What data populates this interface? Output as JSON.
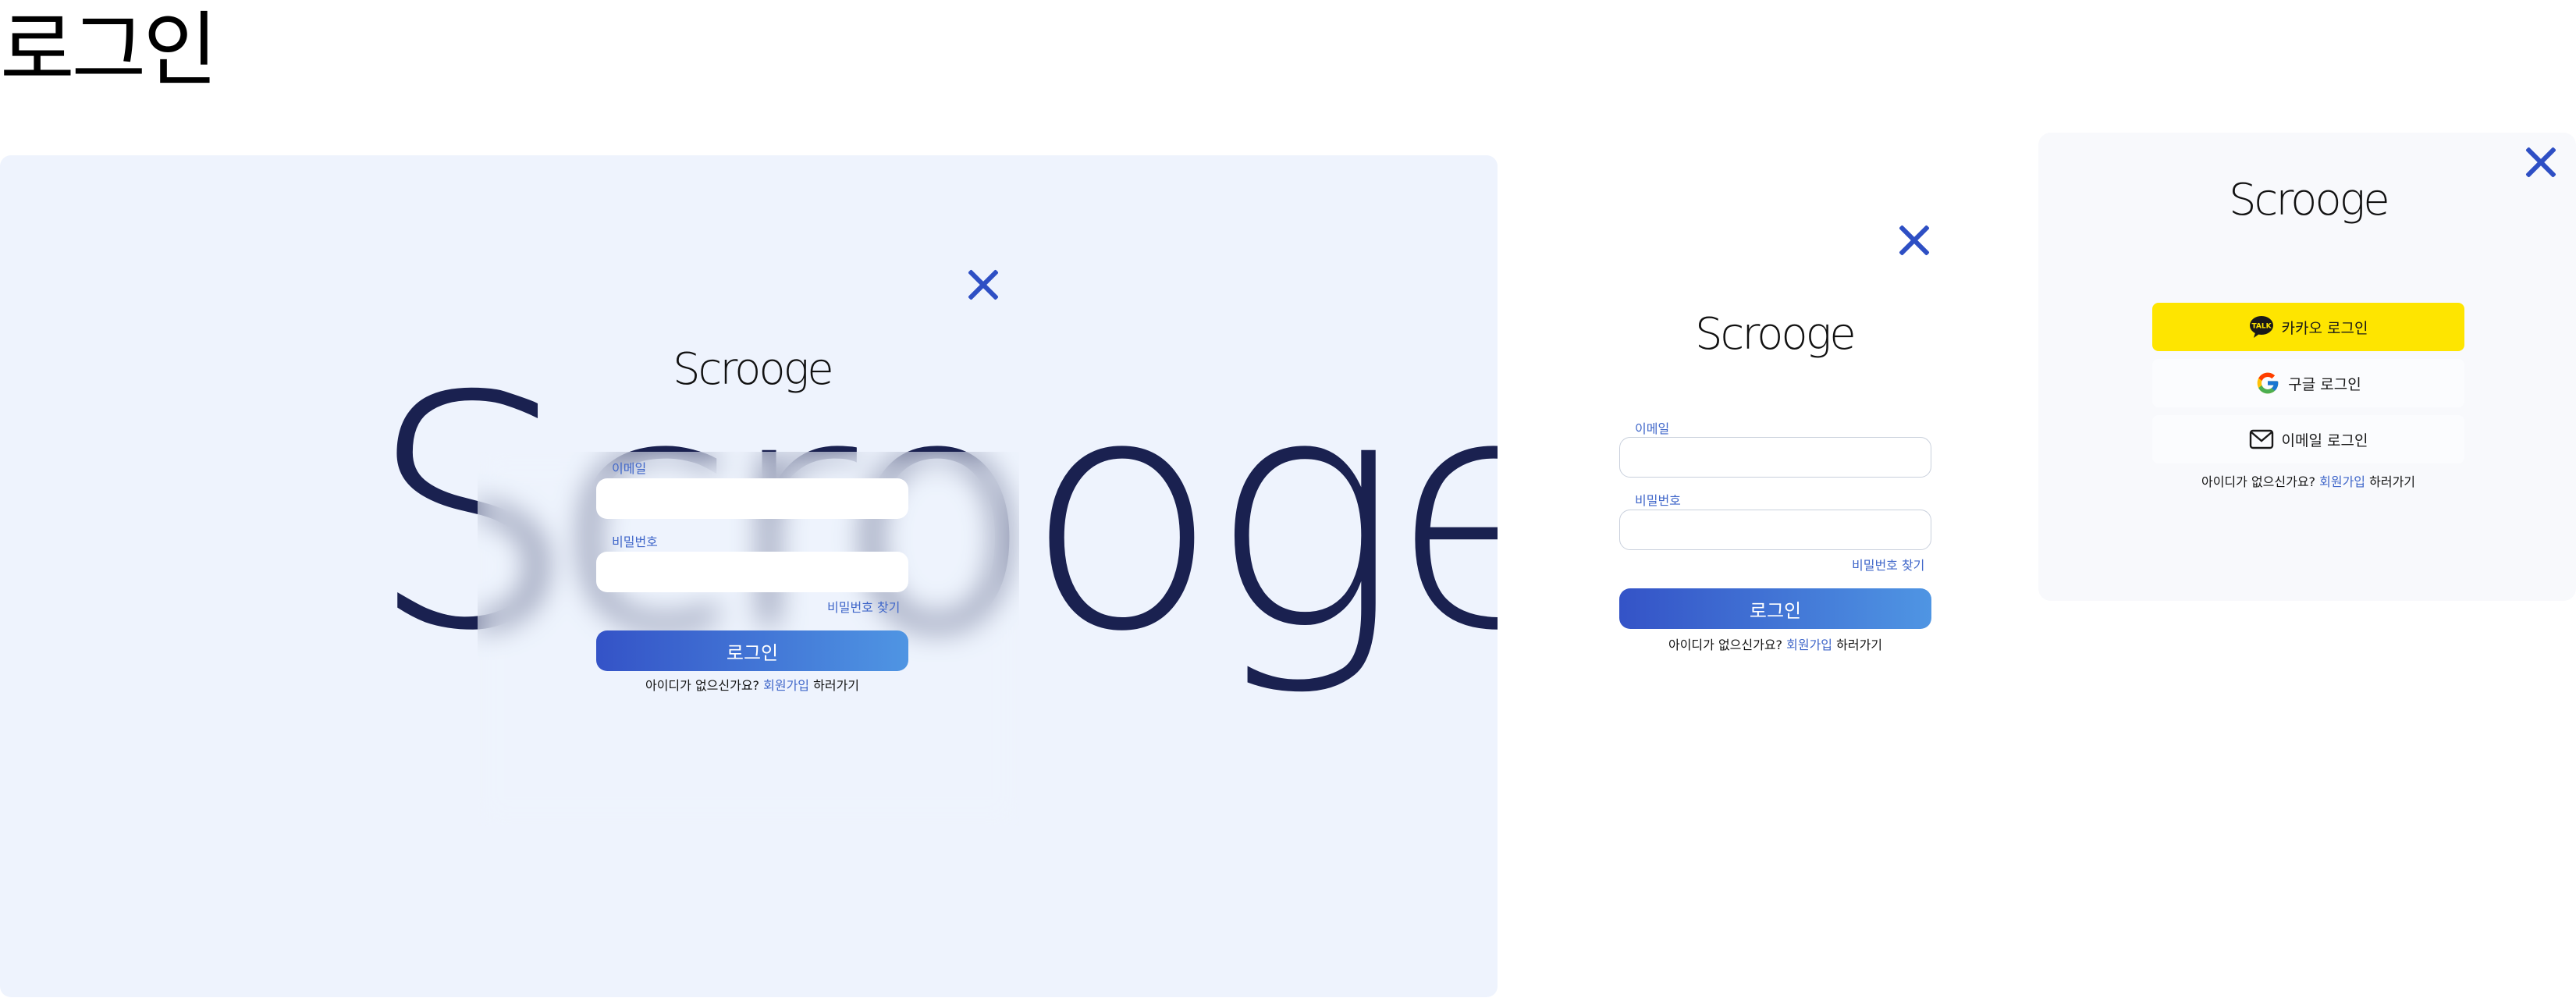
{
  "page_title": "로그인",
  "logo_text": "Scrooge",
  "login_form": {
    "email_label": "이메일",
    "email_value": "",
    "password_label": "비밀번호",
    "password_value": "",
    "find_password": "비밀번호 찾기",
    "login_button": "로그인",
    "signup_prompt": "아이디가 없으신가요?",
    "signup_link": "회원가입",
    "signup_suffix": "하러가기"
  },
  "social": {
    "kakao_label": "카카오 로그인",
    "kakao_badge": "TALK",
    "google_label": "구글 로그인",
    "email_label": "이메일 로그인"
  },
  "colors": {
    "accent": "#2e4fc4",
    "link": "#3f66c9",
    "kakao": "#fee500",
    "panel_bg": "#eef3fd",
    "button_gradient_start": "#3453c7",
    "button_gradient_end": "#4f95e3"
  },
  "icons": [
    "close-icon",
    "kakao-talk-icon",
    "google-g-icon",
    "mail-icon"
  ]
}
